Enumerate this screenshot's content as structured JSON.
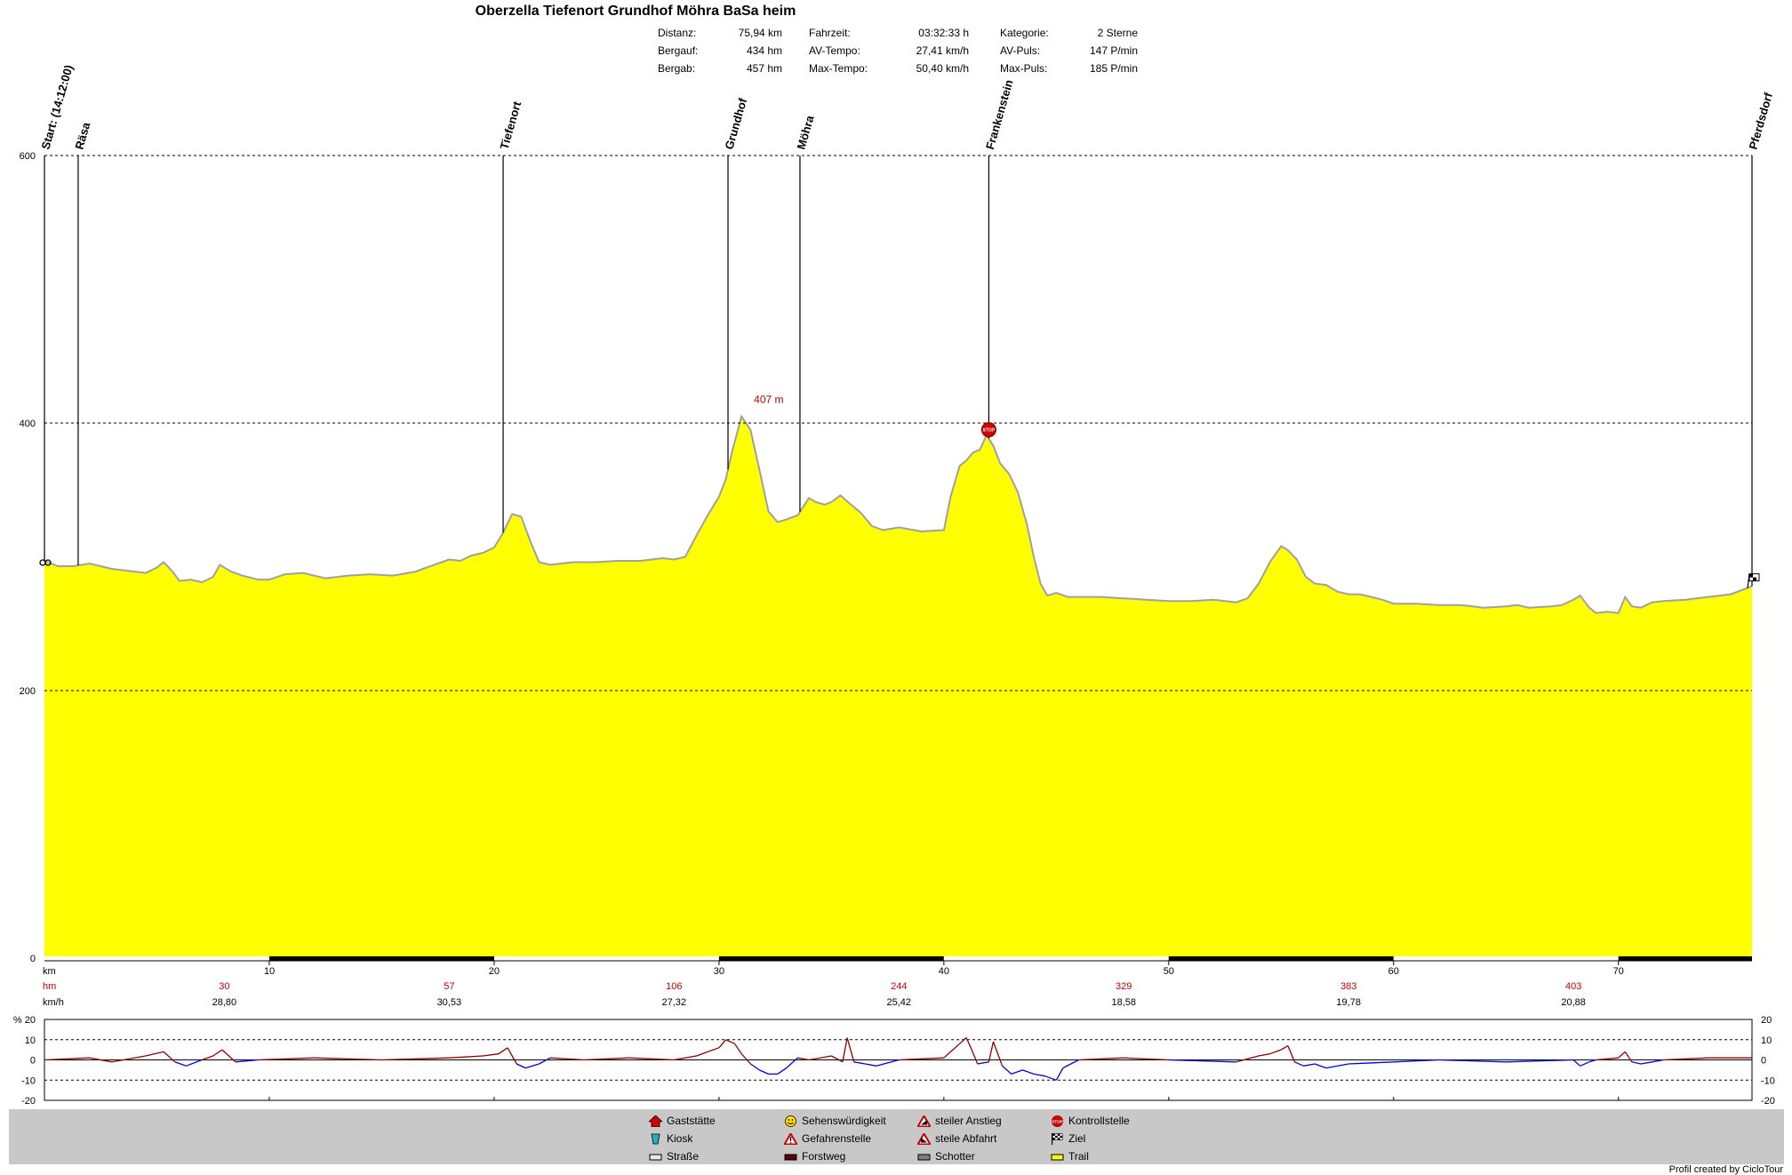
{
  "title": "Oberzella Tiefenort Grundhof Möhra BaSa heim",
  "stats": [
    {
      "label": "Distanz:",
      "value": "75,94 km"
    },
    {
      "label": "Bergauf:",
      "value": "434 hm"
    },
    {
      "label": "Bergab:",
      "value": "457 hm"
    },
    {
      "label": "Fahrzeit:",
      "value": "03:32:33 h"
    },
    {
      "label": "AV-Tempo:",
      "value": "27,41 km/h"
    },
    {
      "label": "Max-Tempo:",
      "value": "50,40 km/h"
    },
    {
      "label": "Kategorie:",
      "value": "2 Sterne"
    },
    {
      "label": "AV-Puls:",
      "value": "147 P/min"
    },
    {
      "label": "Max-Puls:",
      "value": "185 P/min"
    }
  ],
  "chart_data": {
    "type": "area",
    "xlim": [
      0,
      75.94
    ],
    "ylim": [
      0,
      600
    ],
    "yticks": [
      "0",
      "200",
      "400",
      "600"
    ],
    "xticks": [
      "10",
      "20",
      "30",
      "40",
      "50",
      "60",
      "70"
    ],
    "x_unit": "km",
    "fill_color": "#ffff00",
    "line_color": "#a0a0a0",
    "grid": true,
    "series": [
      {
        "x": [
          0,
          0.6,
          1.3,
          2,
          3,
          4,
          4.5,
          5,
          5.3,
          5.7,
          6,
          6.5,
          7,
          7.5,
          7.8,
          8.3,
          8.8,
          9.5,
          10,
          10.7,
          11.5,
          12.5,
          13.5,
          14.5,
          15.5,
          16.5,
          17,
          17.5,
          18,
          18.5,
          19,
          19.5,
          20,
          20.4,
          20.8,
          21.2,
          21.6,
          22,
          22.5,
          23,
          23.5,
          24.5,
          25.5,
          26.5,
          27.5,
          28,
          28.5,
          29,
          29.5,
          30,
          30.3,
          30.6,
          31,
          31.4,
          31.8,
          32.2,
          32.6,
          33,
          33.5,
          34,
          34.3,
          34.7,
          35,
          35.4,
          35.8,
          36.3,
          36.8,
          37.3,
          38,
          39,
          40,
          40.3,
          40.7,
          41,
          41.3,
          41.6,
          41.9,
          42.2,
          42.5,
          42.9,
          43.3,
          43.7,
          44,
          44.3,
          44.6,
          45,
          45.5,
          46,
          47,
          48,
          49,
          50,
          51,
          52,
          53,
          53.5,
          54,
          54.5,
          55,
          55.3,
          55.7,
          56.1,
          56.5,
          57,
          57.5,
          58,
          58.5,
          59,
          59.5,
          60,
          61,
          62,
          63,
          64,
          65,
          65.5,
          66,
          67,
          67.5,
          68,
          68.3,
          68.7,
          69,
          69.5,
          70,
          70.3,
          70.6,
          71,
          71.5,
          72,
          73,
          74,
          75,
          75.94
        ],
        "y": [
          297,
          293,
          293,
          295,
          291,
          289,
          288,
          292,
          296,
          289,
          282,
          283,
          281,
          285,
          294,
          289,
          286,
          283,
          283,
          287,
          288,
          284,
          286,
          287,
          286,
          289,
          292,
          295,
          298,
          297,
          301,
          303,
          307,
          318,
          332,
          330,
          312,
          296,
          294,
          295,
          296,
          296,
          297,
          297,
          299,
          298,
          300,
          316,
          331,
          345,
          358,
          380,
          405,
          395,
          365,
          334,
          326,
          328,
          331,
          344,
          341,
          339,
          341,
          346,
          340,
          333,
          323,
          320,
          322,
          319,
          320,
          345,
          368,
          372,
          378,
          380,
          391,
          383,
          370,
          362,
          348,
          324,
          300,
          280,
          271,
          273,
          270,
          270,
          270,
          269,
          268,
          267,
          267,
          268,
          266,
          269,
          280,
          296,
          308,
          305,
          298,
          285,
          280,
          279,
          274,
          272,
          272,
          270,
          268,
          265,
          265,
          264,
          264,
          262,
          263,
          264,
          262,
          263,
          264,
          268,
          271,
          262,
          258,
          259,
          258,
          270,
          263,
          262,
          266,
          267,
          268,
          270,
          272,
          278
        ],
        "marker_distances": [
          0,
          1.5,
          20.4,
          30.4,
          33.6,
          42,
          75.94
        ]
      }
    ],
    "peak_label": {
      "x": 31,
      "y": 407,
      "text": "407 m"
    },
    "waypoints": [
      {
        "km": 0,
        "label": "Start: (14:12:00)"
      },
      {
        "km": 1.5,
        "label": "Räsa"
      },
      {
        "km": 20.4,
        "label": "Tiefenort"
      },
      {
        "km": 30.4,
        "label": "Grundhof"
      },
      {
        "km": 33.6,
        "label": "Möhra"
      },
      {
        "km": 42,
        "label": "Frankenstein"
      },
      {
        "km": 75.94,
        "label": "Pferdsdorf"
      }
    ],
    "hm_row": {
      "label": "hm",
      "color": "#c00000",
      "values": [
        "30",
        "57",
        "106",
        "244",
        "329",
        "383",
        "403"
      ]
    },
    "kmh_row": {
      "label": "km/h",
      "values": [
        "28,80",
        "30,53",
        "27,32",
        "25,42",
        "18,58",
        "19,78",
        "20,88"
      ]
    },
    "grade": {
      "unit": "%",
      "ylim": [
        -20,
        20
      ],
      "yticks": [
        "20",
        "10",
        "0",
        "-10",
        "-20"
      ],
      "color_up": "#8b0000",
      "color_down": "#0000cc",
      "x": [
        0,
        2,
        3,
        4.5,
        5.3,
        5.8,
        6.3,
        7,
        7.5,
        7.9,
        8.5,
        9.5,
        12,
        15,
        18,
        19.5,
        20.2,
        20.6,
        21,
        21.4,
        22,
        22.5,
        24,
        26,
        28,
        29,
        29.5,
        30,
        30.3,
        30.7,
        31,
        31.4,
        31.8,
        32.2,
        32.6,
        33,
        33.5,
        34,
        35,
        35.5,
        35.7,
        36,
        36.5,
        37,
        38,
        40,
        40.3,
        40.7,
        41,
        41.2,
        41.5,
        42,
        42.2,
        42.6,
        43,
        43.5,
        44,
        44.5,
        45,
        45.3,
        46,
        48,
        50,
        53,
        54,
        54.5,
        55,
        55.3,
        55.6,
        56,
        56.5,
        57,
        58,
        60,
        62,
        65,
        68,
        68.3,
        68.7,
        69,
        70,
        70.3,
        70.6,
        71,
        71.5,
        72,
        74,
        75.94
      ],
      "values": [
        0,
        1,
        -1,
        2,
        4,
        -1,
        -3,
        0,
        2,
        5,
        -1,
        0,
        1,
        0,
        1,
        2,
        3,
        6,
        -2,
        -4,
        -2,
        1,
        0,
        1,
        0,
        2,
        4,
        6,
        10,
        8,
        3,
        -2,
        -5,
        -7,
        -7,
        -4,
        1,
        0,
        2,
        -1,
        11,
        -1,
        -2,
        -3,
        0,
        1,
        4,
        8,
        11,
        6,
        -2,
        -1,
        9,
        -3,
        -7,
        -5,
        -7,
        -8,
        -10,
        -4,
        0,
        1,
        0,
        -1,
        2,
        3,
        5,
        7,
        -1,
        -3,
        -2,
        -4,
        -2,
        -1,
        0,
        -1,
        0,
        -3,
        -1,
        0,
        1,
        4,
        -1,
        -2,
        -1,
        0,
        1,
        1
      ]
    }
  },
  "legend": [
    {
      "label": "Gaststätte",
      "icon": "house-icon"
    },
    {
      "label": "Kiosk",
      "icon": "kiosk-icon"
    },
    {
      "label": "Straße",
      "icon": "road-swatch"
    },
    {
      "label": "Sehenswürdigkeit",
      "icon": "smiley-icon"
    },
    {
      "label": "Gefahrenstelle",
      "icon": "danger-icon"
    },
    {
      "label": "Forstweg",
      "icon": "forest-road-swatch"
    },
    {
      "label": "steiler Anstieg",
      "icon": "steep-climb-icon"
    },
    {
      "label": "steile Abfahrt",
      "icon": "steep-descent-icon"
    },
    {
      "label": "Schotter",
      "icon": "gravel-swatch"
    },
    {
      "label": "Kontrollstelle",
      "icon": "stop-icon"
    },
    {
      "label": "Ziel",
      "icon": "finish-flag-icon"
    },
    {
      "label": "Trail",
      "icon": "trail-swatch"
    }
  ],
  "credit": "Profil created by CicloTour"
}
